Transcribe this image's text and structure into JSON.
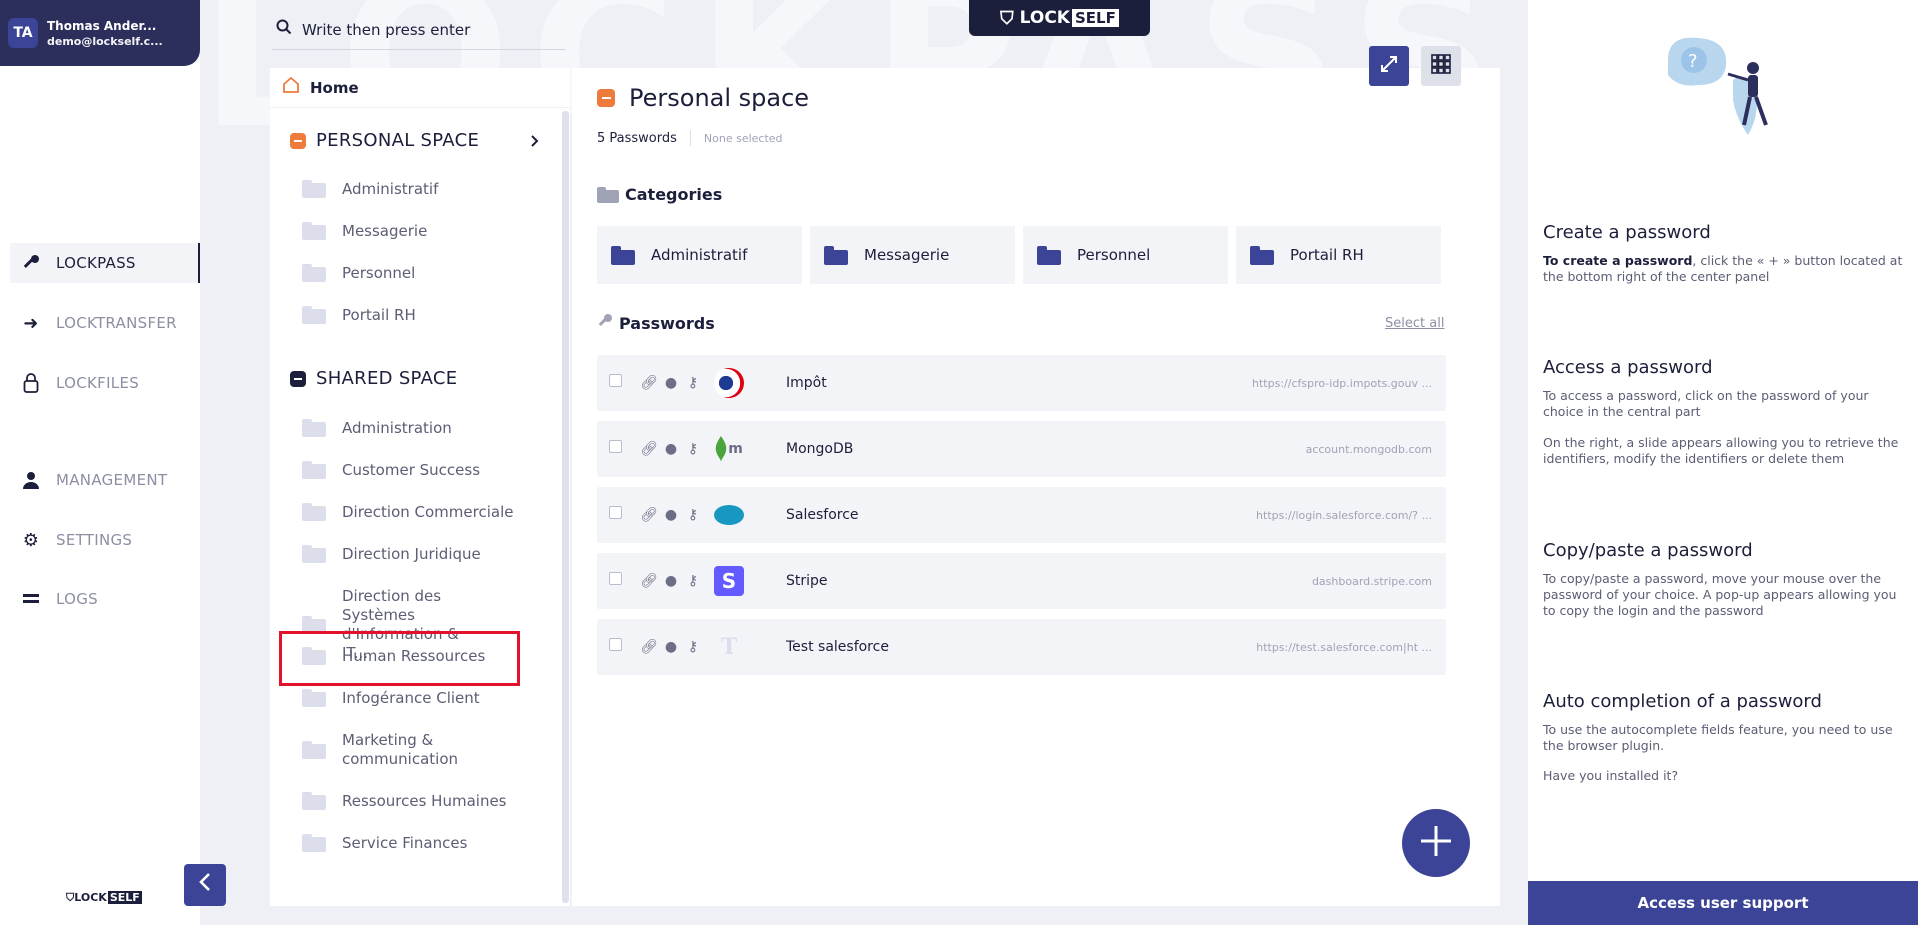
{
  "user": {
    "initials": "TA",
    "name": "Thomas Ander...",
    "email": "demo@lockself.c..."
  },
  "nav": {
    "items": [
      {
        "label": "LOCKPASS",
        "icon": "key-icon",
        "active": true
      },
      {
        "label": "LOCKTRANSFER",
        "icon": "arrow-right-icon",
        "active": false
      },
      {
        "label": "LOCKFILES",
        "icon": "lock-icon",
        "active": false
      },
      {
        "label": "MANAGEMENT",
        "icon": "user-icon",
        "active": false
      },
      {
        "label": "SETTINGS",
        "icon": "gear-icon",
        "active": false
      },
      {
        "label": "LOGS",
        "icon": "list-icon",
        "active": false
      }
    ],
    "collapse_icon": "chevron-left-icon",
    "logo_lock": "LOCK",
    "logo_self": "SELF"
  },
  "brand": {
    "lock": "LOCK",
    "self": "SELF",
    "watermark": "LOCKPASS"
  },
  "search": {
    "placeholder": "Write then press enter"
  },
  "tree": {
    "home": "Home",
    "personal": {
      "title": "PERSONAL SPACE",
      "color": "#ee7a3c",
      "folders": [
        "Administratif",
        "Messagerie",
        "Personnel",
        "Portail RH"
      ]
    },
    "shared": {
      "title": "SHARED SPACE",
      "color": "#1c1f3b",
      "folders": [
        "Administration",
        "Customer Success",
        "Direction Commerciale",
        "Direction Juridique",
        "Direction des Systèmes d'Information & IT...",
        "Human Ressources",
        "Infogérance Client",
        "Marketing & communication",
        "Ressources Humaines",
        "Service Finances"
      ],
      "highlighted": "Human Ressources"
    }
  },
  "main": {
    "title": "Personal space",
    "count": "5 Passwords",
    "selection": "None selected",
    "categories_label": "Categories",
    "categories": [
      "Administratif",
      "Messagerie",
      "Personnel",
      "Portail RH"
    ],
    "passwords_label": "Passwords",
    "select_all": "Select all",
    "passwords": [
      {
        "name": "Impôt",
        "url": "https://cfspro-idp.impots.gouv ...",
        "logo": "impots-logo"
      },
      {
        "name": "MongoDB",
        "url": "account.mongodb.com",
        "logo": "mongodb-logo"
      },
      {
        "name": "Salesforce",
        "url": "https://login.salesforce.com/? ...",
        "logo": "salesforce-logo"
      },
      {
        "name": "Stripe",
        "url": "dashboard.stripe.com",
        "logo": "stripe-logo"
      },
      {
        "name": "Test salesforce",
        "url": "https://test.salesforce.com|ht ...",
        "logo": "letter-t-logo"
      }
    ],
    "add_icon": "plus-icon"
  },
  "help": {
    "sections": [
      {
        "title": "Create a password",
        "bold": "To create a password",
        "text": ", click the « + » button located at the bottom right of the center panel"
      },
      {
        "title": "Access a password",
        "text": "To access a password, click on the password of your choice in the central part",
        "text2": "On the right, a slide appears allowing you to retrieve the identifiers, modify the identifiers or delete them"
      },
      {
        "title": "Copy/paste a password",
        "text": "To copy/paste a password, move your mouse over the password of your choice. A pop-up appears allowing you to copy the login and the password"
      },
      {
        "title": "Auto completion of a password",
        "text": "To use the autocomplete fields feature, you need to use the browser plugin.",
        "text2": "Have you installed it?"
      }
    ],
    "support": "Access user support"
  }
}
